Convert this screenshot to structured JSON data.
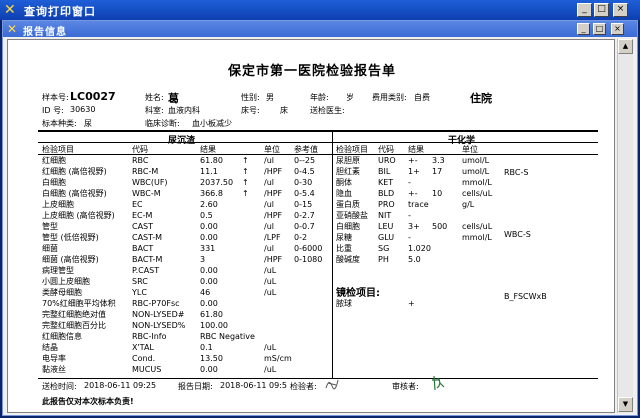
{
  "window": {
    "title": "查询打印窗口",
    "icon": "x-app-icon",
    "min": "_",
    "max": "□",
    "close": "×"
  },
  "panel": {
    "title": "报告信息",
    "icon": "x-app-icon",
    "min": "_",
    "max": "□",
    "close": "×"
  },
  "report": {
    "hospital_title": "保定市第一医院检验报告单",
    "specimen_no_label": "样本号:",
    "specimen_no": "LC0027",
    "name_label": "姓名:",
    "name": "葛",
    "sex_label": "性别:",
    "sex": "男",
    "age_label": "年龄:",
    "age_unit": "岁",
    "fee_label": "费用类别:",
    "fee": "自费",
    "status": "住院",
    "id_label": "ID 号:",
    "id": "30630",
    "dept_label": "科室:",
    "dept": "血液内科",
    "bed_label": "床号:",
    "bed_unit": "床",
    "sender_label": "送检医生:",
    "type_label": "标本种类:",
    "type": "尿",
    "diag_label": "临床诊断:",
    "diag": "血小板减少"
  },
  "left_section": {
    "title": "尿沉渣",
    "headers": [
      "检验项目",
      "代码",
      "结果",
      "单位",
      "参考值"
    ],
    "rows": [
      [
        "红细胞",
        "RBC",
        "61.80",
        "↑",
        "/ul",
        "0--25"
      ],
      [
        "红细胞 (高倍视野)",
        "RBC-M",
        "11.1",
        "↑",
        "/HPF",
        "0-4.5"
      ],
      [
        "白细胞",
        "WBC(UF)",
        "2037.50",
        "↑",
        "/ul",
        "0-30"
      ],
      [
        "白细胞 (高倍视野)",
        "WBC-M",
        "366.8",
        "↑",
        "/HPF",
        "0-5.4"
      ],
      [
        "上皮细胞",
        "EC",
        "2.60",
        "",
        "/ul",
        "0-15"
      ],
      [
        "上皮细胞 (高倍视野)",
        "EC-M",
        "0.5",
        "",
        "/HPF",
        "0-2.7"
      ],
      [
        "管型",
        "CAST",
        "0.00",
        "",
        "/ul",
        "0-0.7"
      ],
      [
        "管型 (低倍视野)",
        "CAST-M",
        "0.00",
        "",
        "/LPF",
        "0-2"
      ],
      [
        "细菌",
        "BACT",
        "331",
        "",
        "/ul",
        "0-6000"
      ],
      [
        "细菌 (高倍视野)",
        "BACT-M",
        "3",
        "",
        "/HPF",
        "0-1080"
      ],
      [
        "病理管型",
        "P.CAST",
        "0.00",
        "",
        "/uL",
        ""
      ],
      [
        "小圆上皮细胞",
        "SRC",
        "0.00",
        "",
        "/uL",
        ""
      ],
      [
        "类酵母细胞",
        "YLC",
        "46",
        "",
        "/uL",
        ""
      ],
      [
        "70%红细胞平均体积",
        "RBC-P70Fsc",
        "0.00",
        "",
        "",
        ""
      ],
      [
        "完整红细胞绝对值",
        "NON-LYSED#",
        "61.80",
        "",
        "",
        ""
      ],
      [
        "完整红细胞百分比",
        "NON-LYSED%",
        "100.00",
        "",
        "",
        ""
      ],
      [
        "红细胞信息",
        "RBC-Info",
        "RBC Negative",
        "",
        "",
        ""
      ],
      [
        "结晶",
        "X'TAL",
        "0.1",
        "",
        "/uL",
        ""
      ],
      [
        "电导率",
        "Cond.",
        "13.50",
        "",
        "mS/cm",
        ""
      ],
      [
        "黏液丝",
        "MUCUS",
        "0.00",
        "",
        "/uL",
        ""
      ]
    ]
  },
  "right_section": {
    "title": "干化学",
    "headers": [
      "检验项目",
      "代码",
      "结果",
      "单位"
    ],
    "rows": [
      [
        "尿胆原",
        "URO",
        "+-",
        "3.3",
        "umol/L"
      ],
      [
        "胆红素",
        "BIL",
        "1+",
        "17",
        "umol/L"
      ],
      [
        "酮体",
        "KET",
        "-",
        "",
        "mmol/L"
      ],
      [
        "隐血",
        "BLD",
        "+-",
        "10",
        "cells/uL"
      ],
      [
        "蛋白质",
        "PRO",
        "trace",
        "",
        "g/L"
      ],
      [
        "亚硝酸盐",
        "NIT",
        "-",
        "",
        ""
      ],
      [
        "白细胞",
        "LEU",
        "3+",
        "500",
        "cells/uL"
      ],
      [
        "尿糖",
        "GLU",
        "-",
        "",
        "mmol/L"
      ],
      [
        "比重",
        "SG",
        "1.020",
        "",
        ""
      ],
      [
        "酸碱度",
        "PH",
        "5.0",
        "",
        ""
      ]
    ],
    "microscopy_title": "镜检项目:",
    "microscopy_rows": [
      [
        "脓球",
        "+"
      ]
    ],
    "charts": [
      "RBC-S",
      "WBC-S",
      "B_FSCWxB"
    ]
  },
  "footer": {
    "send_time_label": "送检时间:",
    "send_time": "2018-06-11 09:25",
    "report_date_label": "报告日期:",
    "report_date": "2018-06-11 09:5",
    "tester_label": "检验者:",
    "reviewer_label": "审核者:",
    "note": "此报告仅对本次标本负责!"
  }
}
